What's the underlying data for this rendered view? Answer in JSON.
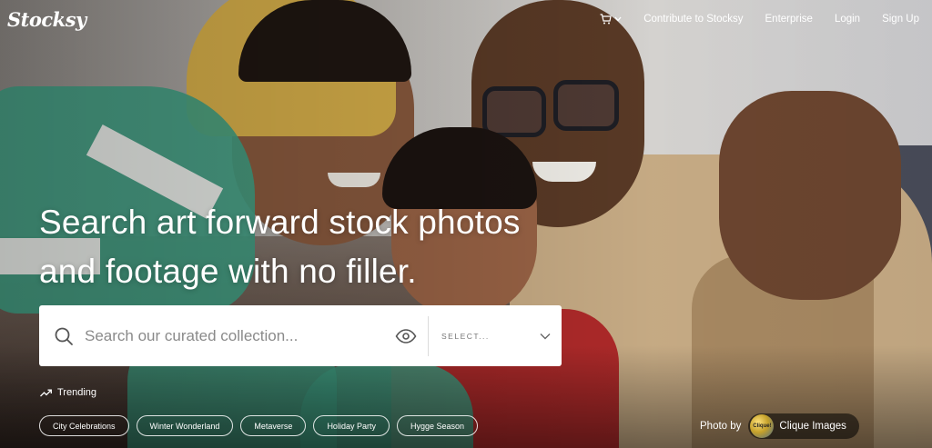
{
  "header": {
    "logo": "Stocksy",
    "nav": {
      "contribute": "Contribute to Stocksy",
      "enterprise": "Enterprise",
      "login": "Login",
      "signup": "Sign Up"
    },
    "cart_icon": "cart-icon"
  },
  "hero": {
    "headline_line1": "Search art forward stock photos",
    "headline_line2": "and footage with no filler."
  },
  "search": {
    "placeholder": "Search our curated collection...",
    "value": "",
    "select_value": "SELECT...",
    "icons": [
      "search-icon",
      "eye-icon",
      "chevron-down-icon"
    ]
  },
  "trending": {
    "label": "Trending",
    "items": [
      "City Celebrations",
      "Winter Wonderland",
      "Metaverse",
      "Holiday Party",
      "Hygge Season"
    ]
  },
  "credit": {
    "prefix": "Photo by",
    "avatar_text": "Clique!",
    "name": "Clique Images"
  },
  "colors": {
    "text": "#ffffff",
    "search_bg": "#ffffff",
    "placeholder": "#8a8a8a"
  }
}
